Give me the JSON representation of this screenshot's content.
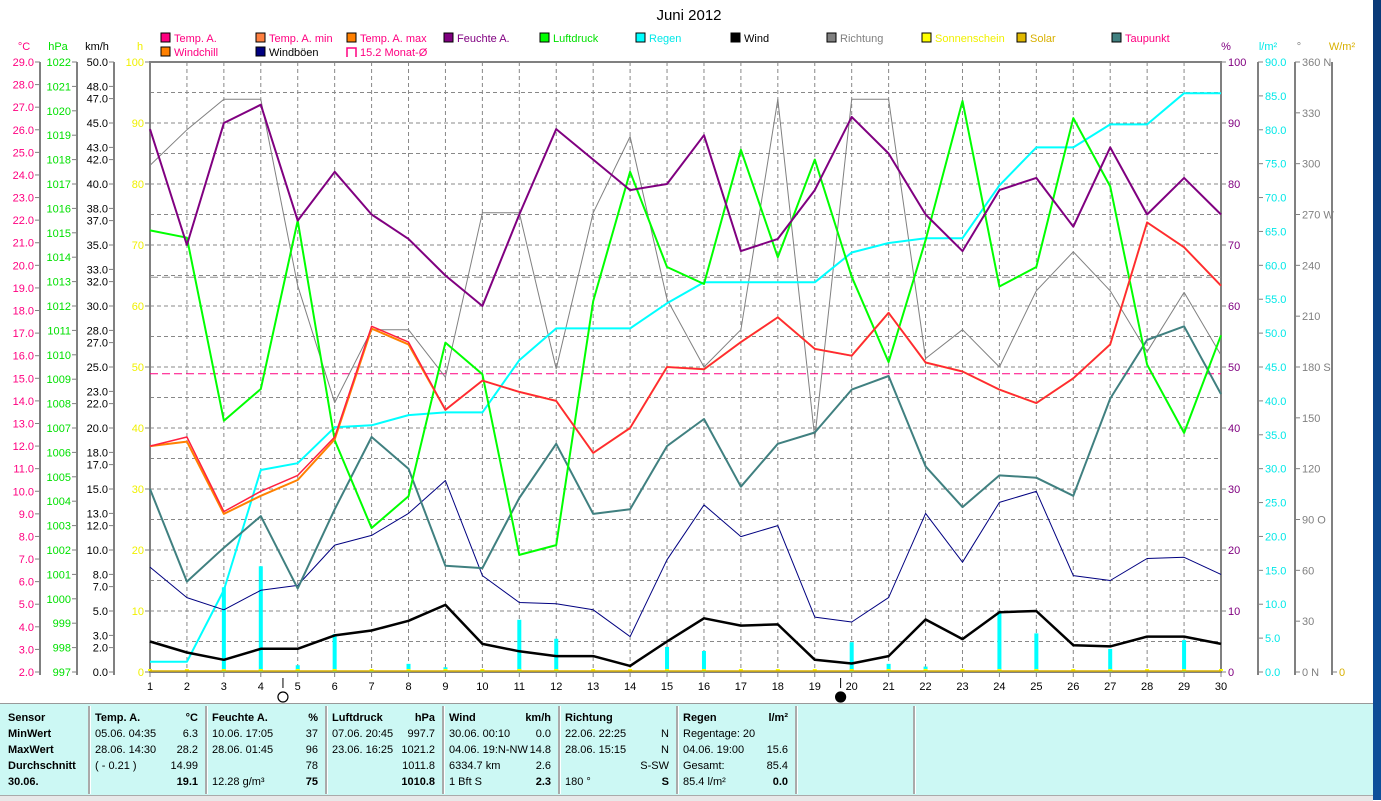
{
  "chart_data": {
    "type": "line",
    "title": "Juni 2012",
    "x": [
      1,
      2,
      3,
      4,
      5,
      6,
      7,
      8,
      9,
      10,
      11,
      12,
      13,
      14,
      15,
      16,
      17,
      18,
      19,
      20,
      21,
      22,
      23,
      24,
      25,
      26,
      27,
      28,
      29,
      30
    ],
    "axes": {
      "temp": {
        "label": "°C",
        "min": 2,
        "max": 29,
        "step": 1,
        "decimals": 1,
        "color": "#ff0080"
      },
      "hpa": {
        "label": "hPa",
        "min": 997,
        "max": 1022,
        "step": 1,
        "decimals": 0,
        "color": "#00e000"
      },
      "kmh": {
        "label": "km/h",
        "min": 0,
        "max": 50,
        "ticks": [
          0,
          2,
          3,
          5,
          7,
          8,
          10,
          12,
          13,
          15,
          17,
          18,
          20,
          22,
          23,
          25,
          27,
          28,
          30,
          32,
          33,
          35,
          37,
          38,
          40,
          42,
          43,
          45,
          47,
          48,
          50
        ],
        "decimals": 1,
        "color": "#000000"
      },
      "h": {
        "label": "h",
        "min": 0,
        "max": 100,
        "step": 10,
        "decimals": 0,
        "color": "#f0f000"
      },
      "pct": {
        "label": "%",
        "min": 0,
        "max": 100,
        "step": 10,
        "decimals": 0,
        "color": "#800080"
      },
      "rain": {
        "label": "l/m²",
        "min": 0,
        "max": 90,
        "step": 5,
        "decimals": 1,
        "color": "#00e8e8"
      },
      "dir": {
        "label": "°",
        "min": 0,
        "max": 360,
        "step": 30,
        "decimals": 0,
        "color": "#808080",
        "compass": {
          "0": "N",
          "90": "O",
          "180": "S",
          "270": "W",
          "360": "N"
        }
      },
      "wm2": {
        "label": "W/m²",
        "min": 0,
        "max": 0,
        "ticks": [
          0
        ],
        "decimals": 0,
        "color": "#d8b000"
      }
    },
    "legend": [
      {
        "name": "Temp. A.",
        "swatch": "#ff0080",
        "text": "#ff0080"
      },
      {
        "name": "Temp. A. min",
        "swatch": "#ff8040",
        "text": "#ff0080"
      },
      {
        "name": "Temp. A. max",
        "swatch": "#ff8000",
        "text": "#ff0080"
      },
      {
        "name": "Feuchte A.",
        "swatch": "#800080",
        "text": "#800080"
      },
      {
        "name": "Luftdruck",
        "swatch": "#00ff00",
        "text": "#00e000"
      },
      {
        "name": "Regen",
        "swatch": "#00ffff",
        "text": "#00e8e8"
      },
      {
        "name": "Wind",
        "swatch": "#000000",
        "text": "#000000"
      },
      {
        "name": "Richtung",
        "swatch": "#808080",
        "text": "#808080"
      },
      {
        "name": "Sonnenschein",
        "swatch": "#ffff00",
        "text": "#f0f000"
      },
      {
        "name": "Solar",
        "swatch": "#e0b800",
        "text": "#d8b000"
      },
      {
        "name": "Taupunkt",
        "swatch": "#408080",
        "text": "#ff0080"
      },
      {
        "name": "Windchill",
        "swatch": "#ff8000",
        "text": "#ff0080"
      },
      {
        "name": "Windböen",
        "swatch": "#000080",
        "text": "#000000"
      },
      {
        "name": "15.2 Monat-Ø",
        "swatch": "none",
        "text": "#ff0080"
      }
    ],
    "series": [
      {
        "name": "Richtung",
        "axis": "dir",
        "color": "#808080",
        "width": 1,
        "values": [
          299,
          320,
          338,
          338,
          228,
          159,
          202,
          202,
          174,
          271,
          271,
          179,
          271,
          316,
          220,
          180,
          202,
          338,
          138,
          338,
          338,
          185,
          202,
          180,
          225,
          248,
          225,
          189,
          224,
          187
        ]
      },
      {
        "name": "Regen",
        "axis": "rain",
        "color": "#00ffff",
        "width": 2,
        "values": [
          1.5,
          1.5,
          12.1,
          29.8,
          30.8,
          36.1,
          36.4,
          37.9,
          38.3,
          38.3,
          46.0,
          50.7,
          50.7,
          50.7,
          54.4,
          57.5,
          57.5,
          57.5,
          57.5,
          61.9,
          63.3,
          64.0,
          64.0,
          71.8,
          77.4,
          77.4,
          80.8,
          80.8,
          85.4,
          85.4
        ]
      },
      {
        "name": "Windböen",
        "axis": "kmh",
        "color": "#000080",
        "width": 1,
        "values": [
          8.6,
          6.1,
          5.1,
          6.7,
          7.1,
          10.4,
          11.2,
          13.0,
          15.7,
          7.9,
          5.7,
          5.6,
          5.1,
          2.9,
          9.2,
          13.7,
          11.1,
          12.0,
          4.5,
          4.1,
          6.1,
          13.0,
          9.0,
          13.9,
          14.8,
          7.9,
          7.5,
          9.3,
          9.4,
          8.0
        ]
      },
      {
        "name": "Wind",
        "axis": "kmh",
        "color": "#000000",
        "width": 2.5,
        "values": [
          2.5,
          1.6,
          1.0,
          1.9,
          1.9,
          3.0,
          3.4,
          4.2,
          5.5,
          2.3,
          1.7,
          1.3,
          1.3,
          0.5,
          2.5,
          4.4,
          3.8,
          3.9,
          1.0,
          0.7,
          1.3,
          4.3,
          2.7,
          4.9,
          5.0,
          2.2,
          2.1,
          2.9,
          2.9,
          2.3
        ]
      },
      {
        "name": "Taupunkt",
        "axis": "temp",
        "color": "#408080",
        "width": 2,
        "values": [
          10.1,
          6.0,
          7.5,
          8.9,
          5.7,
          9.2,
          12.4,
          11.0,
          6.7,
          6.6,
          9.7,
          12.1,
          9.0,
          9.2,
          12.0,
          13.2,
          10.2,
          12.1,
          12.6,
          14.5,
          15.1,
          11.1,
          9.3,
          10.7,
          10.6,
          9.8,
          14.1,
          16.7,
          17.3,
          14.3
        ]
      },
      {
        "name": "Luftdruck",
        "axis": "hpa",
        "color": "#00ff00",
        "width": 2,
        "values": [
          1015.1,
          1014.8,
          1007.3,
          1008.6,
          1015.5,
          1006.5,
          1002.9,
          1004.2,
          1010.5,
          1009.2,
          1001.8,
          1002.2,
          1012.2,
          1017.5,
          1013.6,
          1012.9,
          1018.4,
          1014.0,
          1018.0,
          1013.2,
          1009.7,
          1014.7,
          1020.4,
          1012.8,
          1013.6,
          1019.7,
          1016.9,
          1009.6,
          1006.8,
          1010.8
        ]
      },
      {
        "name": "Feuchte A.",
        "axis": "pct",
        "color": "#800080",
        "width": 2,
        "values": [
          89,
          70,
          90,
          93,
          74,
          82,
          75,
          71,
          65,
          60,
          75,
          89,
          84,
          79,
          80,
          88,
          69,
          71,
          79,
          91,
          85,
          75,
          69,
          79,
          81,
          73,
          86,
          75,
          81,
          75
        ]
      },
      {
        "name": "Windchill",
        "axis": "temp",
        "color": "#ff8000",
        "width": 2,
        "values": [
          12.0,
          12.2,
          9.0,
          9.8,
          10.5,
          12.3,
          17.2,
          16.5,
          13.6,
          14.9,
          14.4,
          14.0,
          11.7,
          12.8,
          15.5,
          15.4,
          16.6,
          17.7,
          16.3,
          16.0,
          17.9,
          15.7,
          15.3,
          14.5,
          13.9,
          15.0,
          16.5,
          21.9,
          20.8,
          19.1
        ]
      },
      {
        "name": "Temp. A.",
        "axis": "temp",
        "color": "#ff2040",
        "width": 1.5,
        "values": [
          12.0,
          12.4,
          9.1,
          10.0,
          10.7,
          12.4,
          17.3,
          16.6,
          13.6,
          14.9,
          14.4,
          14.0,
          11.7,
          12.8,
          15.5,
          15.4,
          16.6,
          17.7,
          16.3,
          16.0,
          17.9,
          15.7,
          15.3,
          14.5,
          13.9,
          15.0,
          16.5,
          21.9,
          20.8,
          19.1
        ]
      }
    ],
    "rain_daily": {
      "axis": "rain",
      "color": "#00ffff",
      "values": [
        0,
        0,
        12.5,
        15.6,
        1.0,
        5.6,
        0.2,
        1.2,
        0.7,
        0.2,
        7.7,
        4.9,
        0,
        0,
        3.7,
        3.1,
        0,
        0,
        0,
        4.4,
        1.2,
        0.8,
        0,
        8.7,
        5.7,
        0,
        3.4,
        0,
        4.7,
        0
      ]
    },
    "sunshine": {
      "axis": "h",
      "color": "#ffff00",
      "values": [
        0,
        0,
        0,
        0,
        0,
        0,
        0,
        0,
        0,
        0,
        0,
        0,
        0,
        0,
        0,
        0,
        0,
        0,
        0,
        0,
        0,
        0,
        0,
        0,
        0,
        0,
        0,
        0,
        0,
        0
      ]
    },
    "solar": {
      "axis": "wm2",
      "color": "#d8b000",
      "values": [
        0,
        0,
        0,
        0,
        0,
        0,
        0,
        0,
        0,
        0,
        0,
        0,
        0,
        0,
        0,
        0,
        0,
        0,
        0,
        0,
        0,
        0,
        0,
        0,
        0,
        0,
        0,
        0,
        0,
        0
      ]
    },
    "reference_lines": [
      {
        "name": "15.2 Monat-Ø",
        "axis": "temp",
        "value": 15.2,
        "color": "#ff0080"
      },
      {
        "name": "Richtung Ø",
        "axis": "dir",
        "value": 233,
        "color": "#909090"
      }
    ],
    "moon_phases": [
      {
        "day": 4.6,
        "type": "full"
      },
      {
        "day": 19.7,
        "type": "new"
      }
    ],
    "grid": true
  },
  "summary": {
    "sensor": {
      "header": "Sensor",
      "rows": [
        "MinWert",
        "MaxWert",
        "Durchschnitt",
        "30.06."
      ]
    },
    "columns": [
      {
        "header": "Temp. A.",
        "unit": "°C",
        "rows": [
          [
            "05.06.  04:35",
            "6.3"
          ],
          [
            "28.06.  14:30",
            "28.2"
          ],
          [
            "( - 0.21 )",
            "14.99"
          ],
          [
            "",
            "19.1"
          ]
        ]
      },
      {
        "header": "Feuchte A.",
        "unit": "%",
        "rows": [
          [
            "10.06.  17:05",
            "37"
          ],
          [
            "28.06.  01:45",
            "96"
          ],
          [
            "",
            "78"
          ],
          [
            "12.28 g/m³",
            "75"
          ]
        ]
      },
      {
        "header": "Luftdruck",
        "unit": "hPa",
        "rows": [
          [
            "07.06.  20:45",
            "997.7"
          ],
          [
            "23.06.  16:25",
            "1021.2"
          ],
          [
            "",
            "1011.8"
          ],
          [
            "",
            "1010.8"
          ]
        ]
      },
      {
        "header": "Wind",
        "unit": "km/h",
        "rows": [
          [
            "30.06.  00:10",
            "0.0"
          ],
          [
            "04.06.  19:N-NW",
            "14.8"
          ],
          [
            "6334.7 km",
            "2.6"
          ],
          [
            "1 Bft S",
            "2.3"
          ]
        ]
      },
      {
        "header": "Richtung",
        "unit": "",
        "rows": [
          [
            "22.06.  22:25",
            "N"
          ],
          [
            "28.06.  15:15",
            "N"
          ],
          [
            "",
            "S-SW"
          ],
          [
            "180 °",
            "S"
          ]
        ]
      },
      {
        "header": "Regen",
        "unit": "l/m²",
        "rows": [
          [
            "Regentage: 20",
            ""
          ],
          [
            "04.06.  19:00",
            "15.6"
          ],
          [
            "Gesamt:",
            "85.4"
          ],
          [
            "85.4 l/m²",
            "0.0"
          ]
        ]
      }
    ]
  }
}
